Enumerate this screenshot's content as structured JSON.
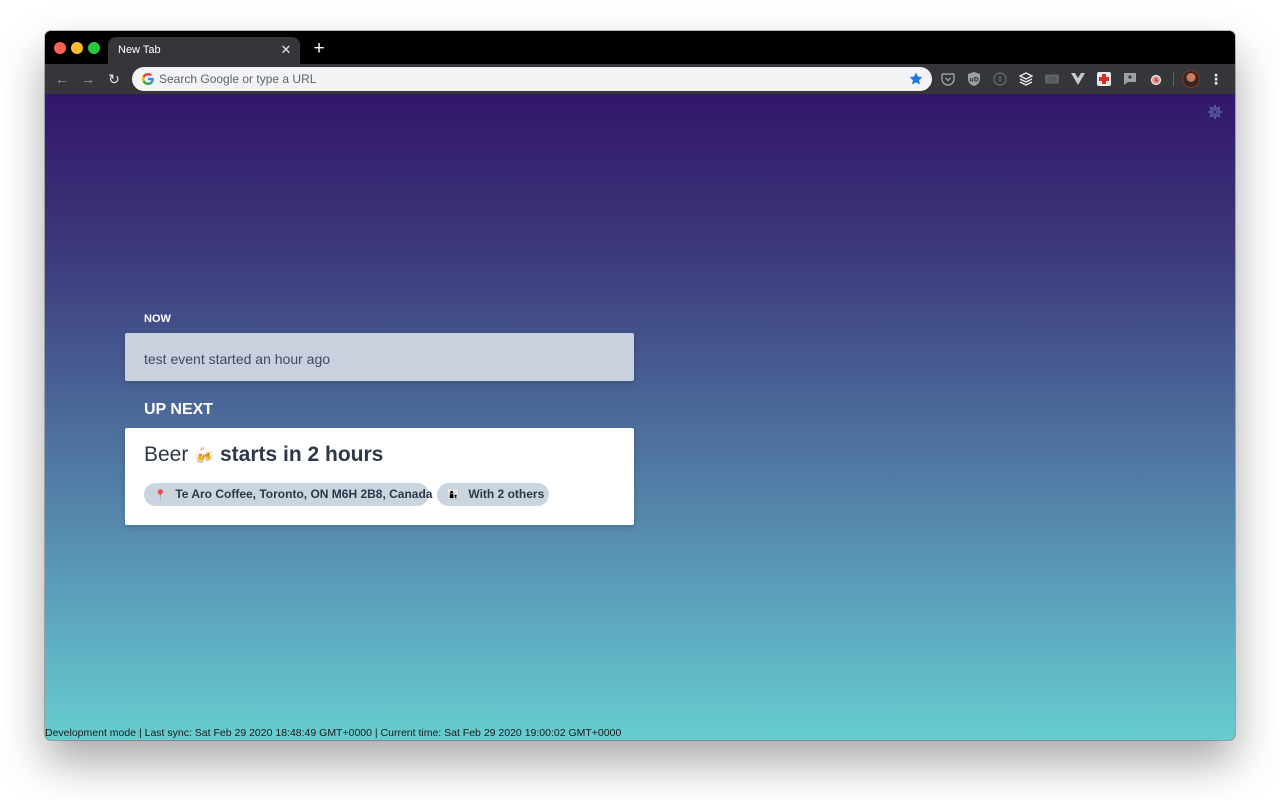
{
  "browser": {
    "tab_title": "New Tab",
    "tab_close_symbol": "✕",
    "new_tab_symbol": "+",
    "back_symbol": "←",
    "forward_symbol": "→",
    "reload_symbol": "↻",
    "menu_symbol": "⋮",
    "omnibox_placeholder": "Search Google or type a URL",
    "icons": {
      "close": "close-icon",
      "new_tab": "plus-icon",
      "back": "arrow-left-icon",
      "forward": "arrow-right-icon",
      "reload": "reload-icon",
      "google": "google-g-icon",
      "bookmark": "star-icon",
      "menu": "kebab-menu-icon",
      "settings": "gear-icon"
    },
    "extensions": [
      "pocket-icon",
      "ublock-icon",
      "info-icon",
      "buffer-icon",
      "tab-counter-icon",
      "vue-devtools-icon",
      "health-icon",
      "feedback-icon",
      "alarm-icon"
    ]
  },
  "app": {
    "now_label": "NOW",
    "now_event_text": "test event started an hour ago",
    "up_next_label": "UP NEXT",
    "next_event": {
      "name": "Beer",
      "emoji": "🍻",
      "starts_text": "starts in 2 hours",
      "location_emoji": "📍",
      "location": "Te Aro Coffee, Toronto, ON M6H 2B8, Canada",
      "people_emoji": "👩‍👦",
      "people": "With 2 others"
    },
    "status_bar": "Development mode | Last sync: Sat Feb 29 2020 18:48:49 GMT+0000 | Current time: Sat Feb 29 2020 19:00:02 GMT+0000"
  },
  "colors": {
    "gradient_top": "#33166a",
    "gradient_bottom": "#66cdd0",
    "now_card": "#c9d0de",
    "chip": "#cbd5e0",
    "star": "#1a73e8"
  }
}
